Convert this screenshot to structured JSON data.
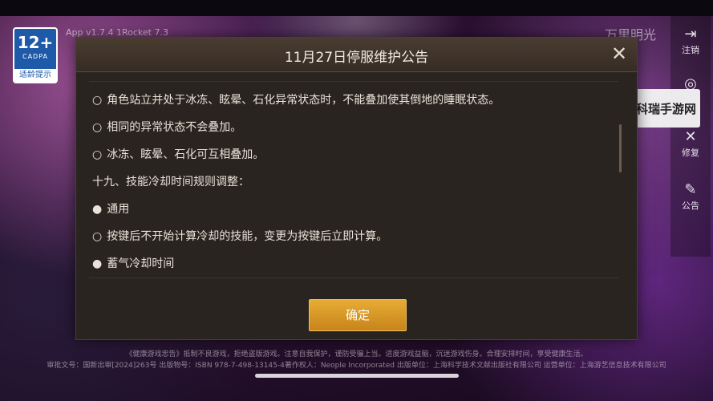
{
  "dialog": {
    "title": "11月27日停服维护公告",
    "confirm_label": "确定",
    "lines": [
      {
        "bullet": "○",
        "text": "角色站立并处于冰冻、眩晕、石化异常状态时，不能叠加使其倒地的睡眠状态。"
      },
      {
        "bullet": "○",
        "text": "相同的异常状态不会叠加。"
      },
      {
        "bullet": "○",
        "text": "冰冻、眩晕、石化可互相叠加。"
      },
      {
        "bullet": "",
        "text": "十九、技能冷却时间规则调整："
      },
      {
        "bullet": "●",
        "text": "通用"
      },
      {
        "bullet": "○",
        "text": "按键后不开始计算冷却的技能，变更为按键后立即计算。"
      },
      {
        "bullet": "●",
        "text": "蓄气冷却时间"
      }
    ]
  },
  "age_badge": {
    "rating": "12+",
    "org": "CADPA",
    "tip": "适龄提示"
  },
  "app_version": "App v1.7.4  1Rocket  7.3",
  "brand": "万里明光",
  "side_menu": [
    {
      "icon": "logout-icon",
      "glyph": "⇥",
      "label": "注销"
    },
    {
      "icon": "user-icon",
      "glyph": "◎",
      "label": ""
    },
    {
      "icon": "repair-icon",
      "glyph": "✕",
      "label": "修复"
    },
    {
      "icon": "announce-icon",
      "glyph": "✎",
      "label": "公告"
    }
  ],
  "site_watermark": "铭茂科瑞手游网",
  "footer": {
    "line1": "《健康游戏忠告》抵制不良游戏，拒绝盗版游戏。注意自我保护，谨防受骗上当。适度游戏益脑，沉迷游戏伤身。合理安排时间，享受健康生活。",
    "line2": "审批文号：国新出审[2024]263号  出版物号：ISBN 978-7-498-13145-4著作权人：Neople Incorporated 出版单位：上海科学技术文献出版社有限公司 运营单位：上海游艺信息技术有限公司"
  }
}
